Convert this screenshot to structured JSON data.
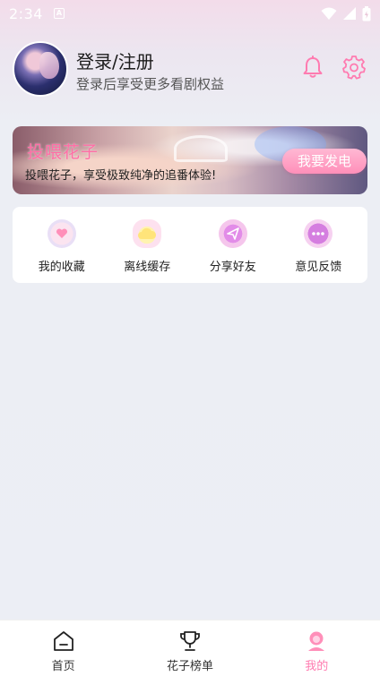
{
  "status_bar": {
    "time": "2:34",
    "notification_glyph": "A"
  },
  "profile": {
    "title": "登录/注册",
    "subtitle": "登录后享受更多看剧权益",
    "icons": [
      "bell-icon",
      "gear-icon"
    ],
    "accent_color": "#ff7bb0"
  },
  "banner": {
    "title": "投喂花子",
    "description": "投喂花子，享受极致纯净的追番体验!",
    "button_label": "我要发电"
  },
  "quick_actions": [
    {
      "label": "我的收藏",
      "icon": "favorite-icon"
    },
    {
      "label": "离线缓存",
      "icon": "cloud-download-icon"
    },
    {
      "label": "分享好友",
      "icon": "share-icon"
    },
    {
      "label": "意见反馈",
      "icon": "feedback-icon"
    }
  ],
  "bottom_nav": {
    "items": [
      {
        "label": "首页",
        "icon": "home-icon"
      },
      {
        "label": "花子榜单",
        "icon": "trophy-icon"
      },
      {
        "label": "我的",
        "icon": "profile-icon"
      }
    ],
    "active_index": 2
  }
}
